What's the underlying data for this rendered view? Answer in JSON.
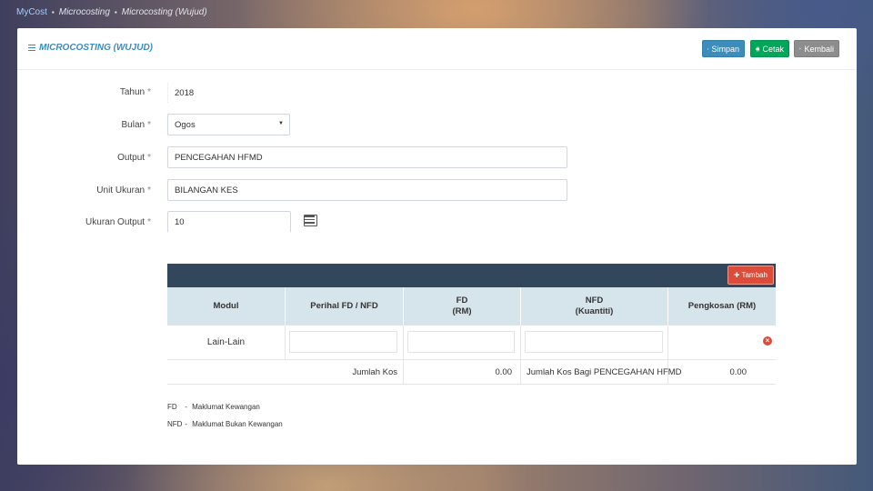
{
  "breadcrumb": {
    "home": "MyCost",
    "level1": "Microcosting",
    "level2": "Microcosting (Wujud)",
    "separator": "▪"
  },
  "header": {
    "title": "MICROCOSTING (WUJUD)",
    "buttons": {
      "save": "Simpan",
      "print": "Cetak",
      "back": "Kembali"
    }
  },
  "form": {
    "required_mark": "*",
    "tahun": {
      "label": "Tahun",
      "value": "2018"
    },
    "bulan": {
      "label": "Bulan",
      "value": "Ogos"
    },
    "output": {
      "label": "Output",
      "value": "PENCEGAHAN HFMD"
    },
    "unit_ukuran": {
      "label": "Unit Ukuran",
      "value": "BILANGAN KES"
    },
    "ukuran_output": {
      "label": "Ukuran Output",
      "value": "10"
    }
  },
  "table": {
    "add_button": "Tambah",
    "headers": {
      "modul": "Modul",
      "perihal": "Perihal FD / NFD",
      "fd_line1": "FD",
      "fd_line2": "(RM)",
      "nfd_line1": "NFD",
      "nfd_line2": "(Kuantiti)",
      "pengkosan": "Pengkosan (RM)"
    },
    "rows": [
      {
        "modul": "Lain-Lain",
        "perihal": "",
        "fd": "",
        "nfd": "",
        "pengkosan": ""
      }
    ],
    "footer": {
      "jumlah_kos_label": "Jumlah Kos",
      "jumlah_kos_value": "0.00",
      "jumlah_bagi_label": "Jumlah Kos Bagi PENCEGAHAN HFMD",
      "jumlah_bagi_value": "0.00"
    }
  },
  "legend": {
    "fd": {
      "abbr": "FD",
      "dash": "-",
      "text": "Maklumat Kewangan"
    },
    "nfd": {
      "abbr": "NFD",
      "dash": "-",
      "text": "Maklumat Bukan Kewangan"
    }
  },
  "colors": {
    "primary": "#3c8dbc",
    "success": "#00a65a",
    "muted": "#8d8d8d",
    "danger": "#dd4b39",
    "table_top": "#33475c",
    "table_head": "#d6e4ec"
  }
}
